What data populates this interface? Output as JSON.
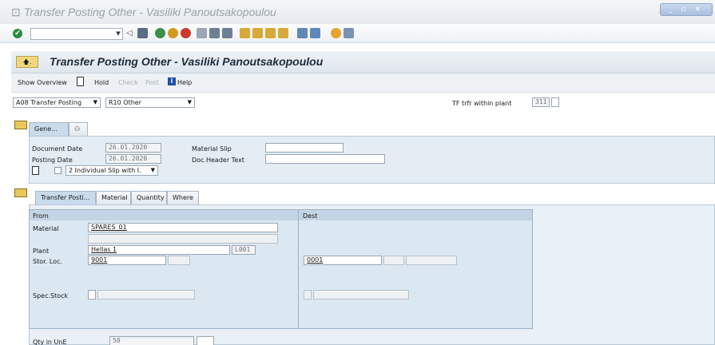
{
  "window": {
    "title": "Transfer Posting Other - Vasiliki Panoutsakopoulou",
    "controls": "_ ▫ ✕"
  },
  "app": {
    "title": "Transfer Posting Other - Vasiliki Panoutsakopoulou"
  },
  "toolbar": {
    "show_overview": "Show Overview",
    "hold": "Hold",
    "check": "Check",
    "post": "Post",
    "help": "Help"
  },
  "header": {
    "transaction": "A08 Transfer Posting",
    "reference": "R10 Other",
    "tf_label": "TF trfr within plant",
    "movement_type": "311"
  },
  "general": {
    "tab": "Gene...",
    "document_date_label": "Document Date",
    "document_date": "26.01.2020",
    "posting_date_label": "Posting Date",
    "posting_date": "26.01.2020",
    "material_slip_label": "Material Slip",
    "material_slip": "",
    "doc_header_label": "Doc.Header Text",
    "doc_header": "",
    "print_option": "2 Individual Slip with I."
  },
  "item_tabs": [
    "Transfer Posti...",
    "Material",
    "Quantity",
    "Where"
  ],
  "transfer": {
    "from_label": "From",
    "dest_label": "Dest",
    "material_label": "Material",
    "material": "SPARES_01",
    "plant_label": "Plant",
    "plant": "Hellas 1",
    "plant_code": "L001",
    "stor_loc_label": "Stor. Loc.",
    "stor_loc_from": "9001",
    "stor_loc_dest": "0001",
    "spec_stock_label": "Spec.Stock",
    "qty_label": "Qty in UnE",
    "qty": "50"
  },
  "colors": {
    "accent": "#1d2b39",
    "panel": "#e4edf4",
    "folder": "#e8c85a"
  }
}
